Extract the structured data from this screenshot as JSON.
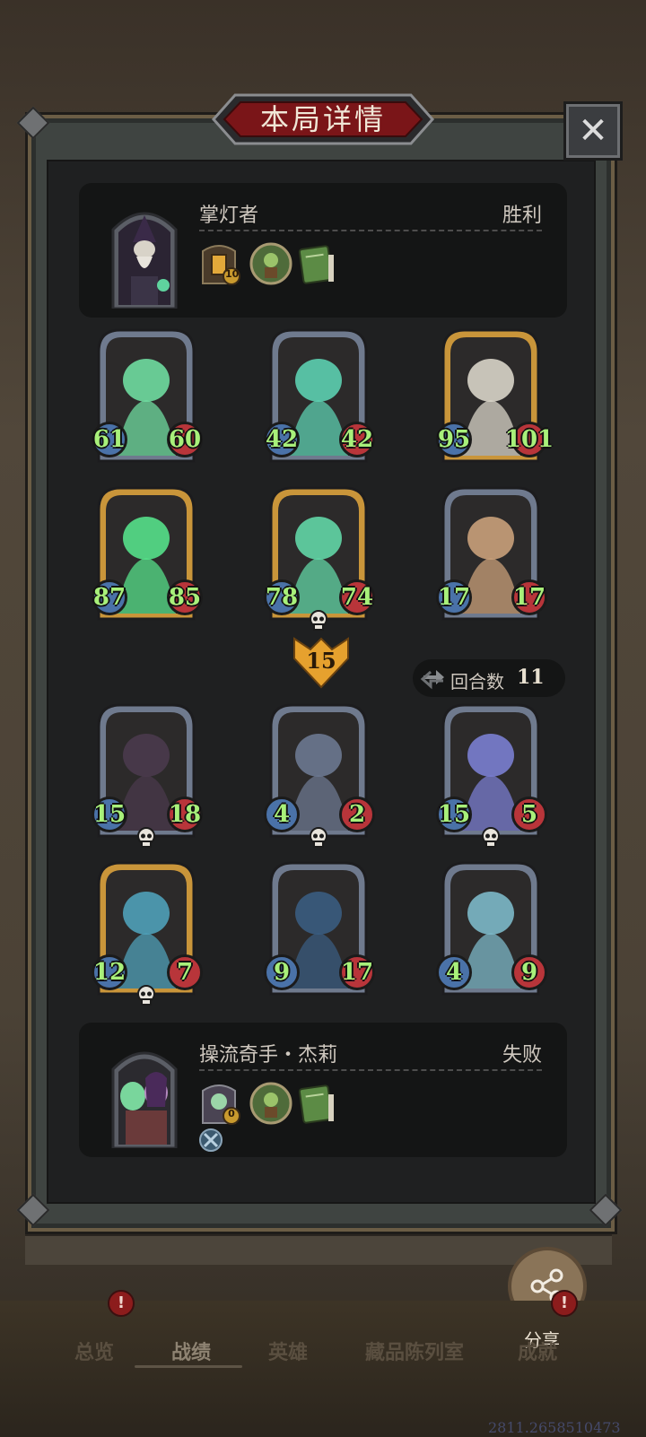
{
  "dialog": {
    "title": "本局详情",
    "close_label": "✕"
  },
  "player_top": {
    "name": "掌灯者",
    "result": "胜利",
    "hero_level": "10"
  },
  "board_top": [
    {
      "attack": "61",
      "health": "60",
      "frame": "silver",
      "portrait": "ghost-cat"
    },
    {
      "attack": "42",
      "health": "42",
      "frame": "silver",
      "portrait": "spectral-spirit"
    },
    {
      "attack": "95",
      "health": "101",
      "frame": "gold",
      "portrait": "reaper-skeleton"
    },
    {
      "attack": "87",
      "health": "85",
      "frame": "gold",
      "portrait": "ghost-rogue"
    },
    {
      "attack": "78",
      "health": "74",
      "frame": "gold",
      "portrait": "ghost-brute",
      "dead": true
    },
    {
      "attack": "17",
      "health": "17",
      "frame": "silver",
      "portrait": "hunter-hornblower"
    }
  ],
  "damage": "15",
  "turns": {
    "label": "回合数",
    "value": "11"
  },
  "board_bottom": [
    {
      "attack": "15",
      "health": "18",
      "frame": "silver",
      "portrait": "shadow-dragon",
      "dead": true
    },
    {
      "attack": "4",
      "health": "2",
      "frame": "silver",
      "portrait": "bone-dragon",
      "dead": true
    },
    {
      "attack": "15",
      "health": "5",
      "frame": "silver",
      "portrait": "azure-dragon",
      "dead": true
    },
    {
      "attack": "12",
      "health": "7",
      "frame": "gold",
      "portrait": "dragon-tamer",
      "dead": true
    },
    {
      "attack": "9",
      "health": "17",
      "frame": "silver",
      "portrait": "sea-dragon"
    },
    {
      "attack": "4",
      "health": "9",
      "frame": "silver",
      "portrait": "ice-dragon"
    }
  ],
  "player_bottom": {
    "name": "操流奇手・杰莉",
    "result": "失败",
    "hero_level": "0"
  },
  "share_label": "分享",
  "tabs": [
    {
      "label": "总览",
      "badge": "!"
    },
    {
      "label": "战绩",
      "active": true
    },
    {
      "label": "英雄"
    },
    {
      "label": "藏品陈列室"
    },
    {
      "label": "成就",
      "badge": "!"
    }
  ],
  "coords_readout": "2811.2658510473",
  "colors": {
    "attack_fill": "#4a72a8",
    "health_fill": "#b8353a",
    "stat_text": "#a8f07a",
    "silver_frame": "#6f7a8e",
    "gold_frame": "#c9953a",
    "title_banner": "#7a1518"
  }
}
